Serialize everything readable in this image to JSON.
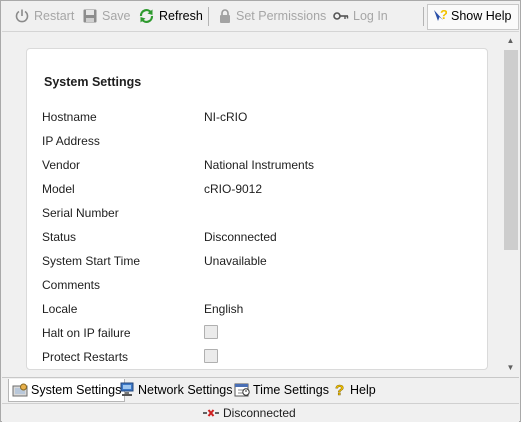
{
  "toolbar": {
    "restart": "Restart",
    "save": "Save",
    "refresh": "Refresh",
    "set_permissions": "Set Permissions",
    "log_in": "Log In",
    "show_help": "Show Help"
  },
  "panel": {
    "title": "System Settings",
    "fields": [
      {
        "label": "Hostname",
        "value": "NI-cRIO"
      },
      {
        "label": "IP Address",
        "value": ""
      },
      {
        "label": "Vendor",
        "value": "National Instruments"
      },
      {
        "label": "Model",
        "value": "cRIO-9012"
      },
      {
        "label": "Serial Number",
        "value": ""
      },
      {
        "label": "Status",
        "value": "Disconnected"
      },
      {
        "label": "System Start Time",
        "value": "Unavailable"
      },
      {
        "label": "Comments",
        "value": ""
      },
      {
        "label": "Locale",
        "value": "English"
      },
      {
        "label": "Halt on IP failure",
        "checked": false
      },
      {
        "label": "Protect Restarts",
        "checked": false
      }
    ]
  },
  "tabs": [
    {
      "label": "System Settings",
      "icon": "system-settings-icon",
      "active": true
    },
    {
      "label": "Network Settings",
      "icon": "network-icon",
      "active": false
    },
    {
      "label": "Time Settings",
      "icon": "calendar-clock-icon",
      "active": false
    },
    {
      "label": "Help",
      "icon": "help-icon",
      "active": false
    }
  ],
  "status_bar": {
    "text": "Disconnected",
    "icon": "disconnected-icon"
  },
  "colors": {
    "refresh_green": "#2e9a2e",
    "help_yellow": "#f2c200",
    "disabled_text": "#a6a6a6",
    "disconnect_red": "#cc2020"
  }
}
